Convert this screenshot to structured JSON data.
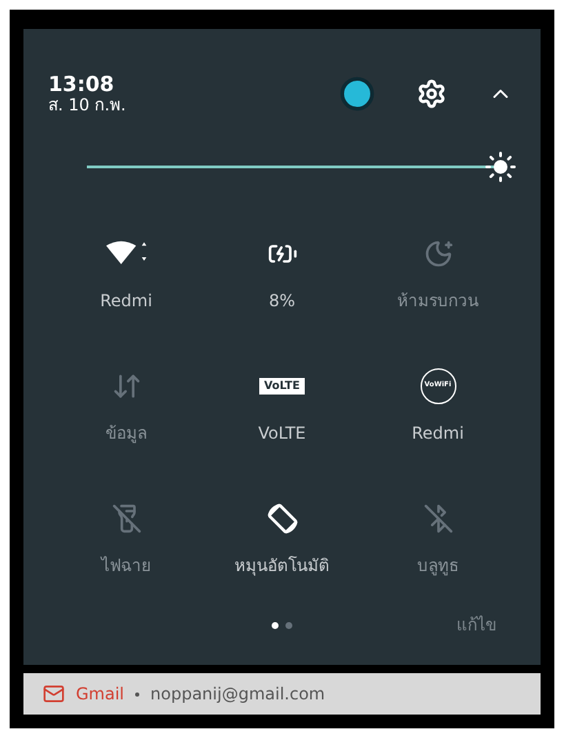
{
  "header": {
    "time": "13:08",
    "date": "ส. 10 ก.พ."
  },
  "brightness": {
    "level": 0.97
  },
  "tiles": [
    {
      "kind": "icon",
      "label": "Redmi",
      "on": true
    },
    {
      "kind": "icon",
      "label": "8%",
      "on": true
    },
    {
      "kind": "icon",
      "label": "ห้ามรบกวน",
      "on": false
    },
    {
      "kind": "icon",
      "label": "ข้อมูล",
      "on": false
    },
    {
      "kind": "badge",
      "badge": "VoLTE",
      "label": "VoLTE",
      "on": true
    },
    {
      "kind": "round-badge",
      "badge": "VoWiFi",
      "label": "Redmi",
      "on": true
    },
    {
      "kind": "icon",
      "label": "ไฟฉาย",
      "on": false
    },
    {
      "kind": "icon",
      "label": "หมุนอัตโนมัติ",
      "on": true
    },
    {
      "kind": "icon",
      "label": "บลูทูธ",
      "on": false
    }
  ],
  "pages": [
    {
      "selected": true
    },
    {
      "selected": false
    }
  ],
  "edit_button": "แก้ไข",
  "notification": {
    "app": "Gmail",
    "account": "noppanij@gmail.com"
  }
}
